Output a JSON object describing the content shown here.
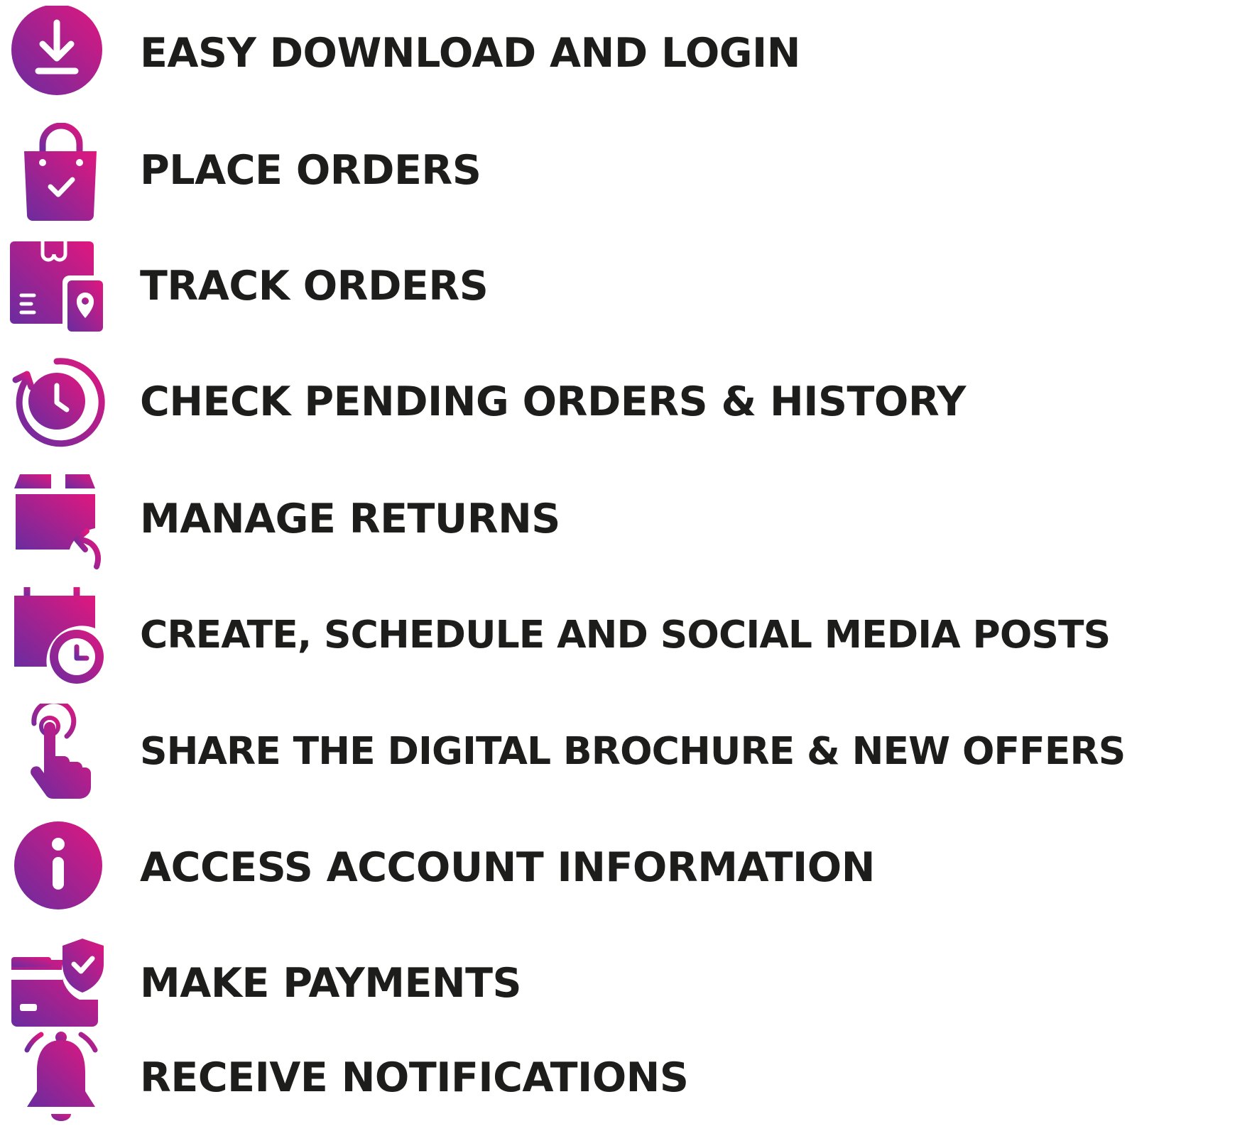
{
  "colors": {
    "gradient_start": "#6a2ca0",
    "gradient_end": "#e0177e",
    "text": "#1d1d1b",
    "background": "#ffffff"
  },
  "features": [
    {
      "icon": "download-icon",
      "label": "EASY DOWNLOAD AND LOGIN"
    },
    {
      "icon": "shopping-bag-check-icon",
      "label": "PLACE ORDERS"
    },
    {
      "icon": "package-tracking-icon",
      "label": "TRACK ORDERS"
    },
    {
      "icon": "clock-history-icon",
      "label": "CHECK PENDING ORDERS & HISTORY"
    },
    {
      "icon": "box-return-icon",
      "label": "MANAGE RETURNS"
    },
    {
      "icon": "calendar-clock-icon",
      "label": "CREATE, SCHEDULE AND SOCIAL MEDIA POSTS"
    },
    {
      "icon": "tap-hand-icon",
      "label": "SHARE THE DIGITAL BROCHURE & NEW OFFERS"
    },
    {
      "icon": "info-icon",
      "label": "ACCESS ACCOUNT INFORMATION"
    },
    {
      "icon": "card-shield-icon",
      "label": "MAKE PAYMENTS"
    },
    {
      "icon": "bell-icon",
      "label": "RECEIVE NOTIFICATIONS"
    }
  ]
}
